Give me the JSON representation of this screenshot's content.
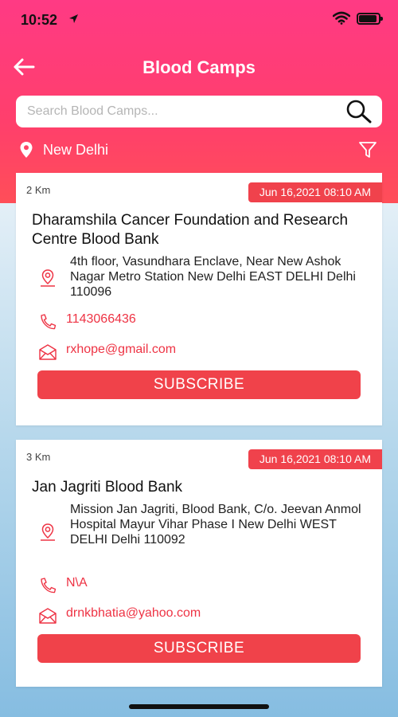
{
  "status_bar": {
    "time": "10:52"
  },
  "header": {
    "title": "Blood Camps"
  },
  "search": {
    "placeholder": "Search Blood Camps..."
  },
  "location": {
    "city": "New Delhi"
  },
  "camps": [
    {
      "distance": "2 Km",
      "date": "Jun 16,2021 08:10 AM",
      "name": "Dharamshila Cancer Foundation and Research Centre Blood Bank",
      "address": "4th floor, Vasundhara Enclave, Near New Ashok Nagar Metro Station New Delhi EAST DELHI Delhi 110096",
      "phone": "1143066436",
      "email": "rxhope@gmail.com",
      "button_label": "SUBSCRIBE"
    },
    {
      "distance": "3 Km",
      "date": "Jun 16,2021 08:10 AM",
      "name": "Jan Jagriti Blood Bank",
      "address": "Mission Jan Jagriti, Blood Bank, C/o. Jeevan Anmol Hospital Mayur Vihar Phase I  New Delhi WEST DELHI Delhi 110092",
      "phone": "N\\A",
      "email": "drnkbhatia@yahoo.com",
      "button_label": "SUBSCRIBE"
    }
  ],
  "colors": {
    "header_gradient_top": "#ff3a84",
    "header_gradient_bottom": "#ff4e58",
    "accent_red": "#f0424a",
    "link_red": "#ee3344"
  }
}
